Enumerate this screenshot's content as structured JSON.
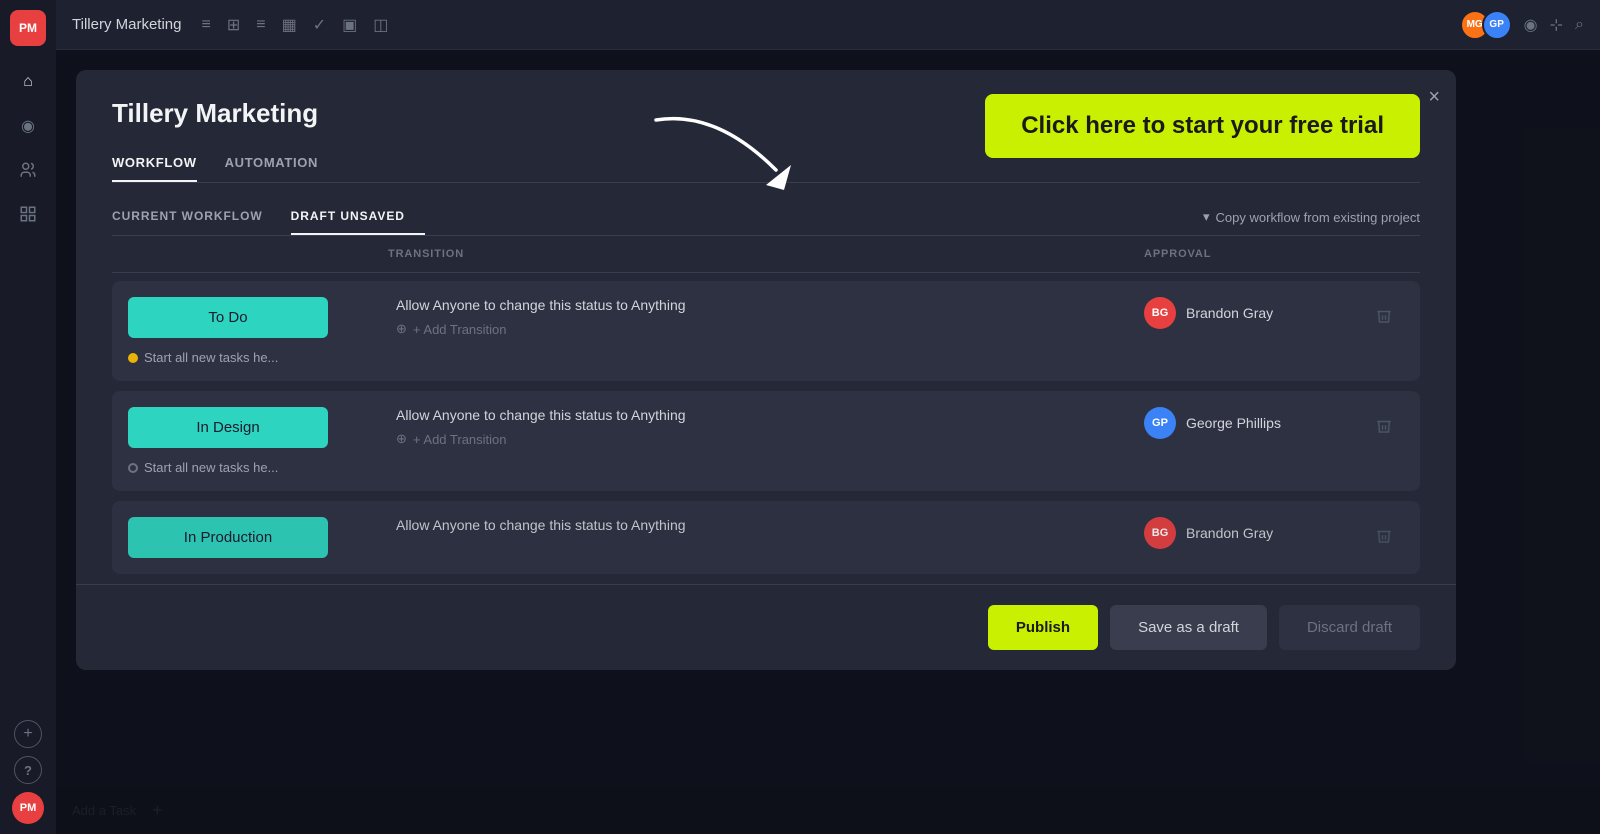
{
  "app": {
    "title": "Tillery Marketing",
    "logo": "PM"
  },
  "topbar": {
    "title": "Tillery Marketing",
    "avatars": [
      {
        "initials": "MG",
        "color": "#f97316"
      },
      {
        "initials": "GP",
        "color": "#3b82f6"
      }
    ],
    "icons": [
      "≡",
      "⊞",
      "≡",
      "▦",
      "✓",
      "▣",
      "◫"
    ]
  },
  "sidebar": {
    "icons": [
      "⌂",
      "◎",
      "◉",
      "👤",
      "🧳"
    ],
    "bottom_icons": [
      "+",
      "?"
    ]
  },
  "modal": {
    "title": "Tillery Marketing",
    "tabs": [
      {
        "label": "WORKFLOW",
        "active": true
      },
      {
        "label": "AUTOMATION",
        "active": false
      }
    ],
    "close_label": "×",
    "free_trial": {
      "text": "Click here to start your free trial",
      "bg_color": "#c8f000"
    },
    "workflow": {
      "tabs": [
        {
          "label": "CURRENT WORKFLOW",
          "active": false
        },
        {
          "label": "DRAFT UNSAVED",
          "active": true
        }
      ],
      "copy_btn": "Copy workflow from existing project",
      "table_headers": {
        "status": "",
        "transition": "TRANSITION",
        "approval": "APPROVAL",
        "actions": ""
      },
      "rows": [
        {
          "status_label": "To Do",
          "status_color": "#2dd4bf",
          "transition_text": "Allow Anyone to change this status to Anything",
          "add_transition": "+ Add Transition",
          "start_tasks": "Start all new tasks he...",
          "dot_type": "yellow",
          "approver_name": "Brandon Gray",
          "approver_initials": "BG",
          "approver_avatar_color": "#e84040"
        },
        {
          "status_label": "In Design",
          "status_color": "#2dd4bf",
          "transition_text": "Allow Anyone to change this status to Anything",
          "add_transition": "+ Add Transition",
          "start_tasks": "Start all new tasks he...",
          "dot_type": "gray",
          "approver_name": "George Phillips",
          "approver_initials": "GP",
          "approver_avatar_color": "#3b82f6"
        },
        {
          "status_label": "In Production",
          "status_color": "#2dd4bf",
          "transition_text": "Allow Anyone to change this status to Anything",
          "add_transition": "",
          "start_tasks": "",
          "dot_type": "none",
          "approver_name": "Brandon Gray",
          "approver_initials": "BG",
          "approver_avatar_color": "#e84040"
        }
      ]
    },
    "footer": {
      "publish_label": "Publish",
      "draft_label": "Save as a draft",
      "discard_label": "Discard draft"
    }
  },
  "background": {
    "add_task_label": "Add a Task",
    "add_icon": "+"
  }
}
